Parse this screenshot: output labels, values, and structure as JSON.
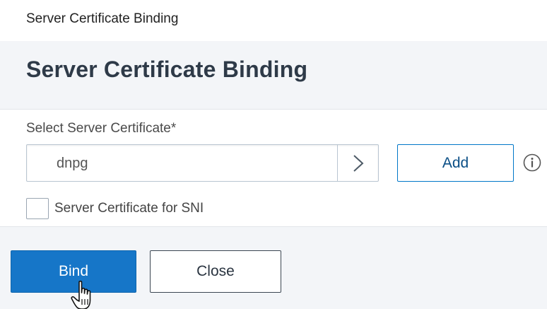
{
  "breadcrumb": "Server Certificate Binding",
  "panel": {
    "title": "Server Certificate Binding"
  },
  "form": {
    "field_label": "Select Server Certificate*",
    "selected_certificate": "dnpg",
    "add_label": "Add",
    "sni_label": "Server Certificate for SNI",
    "sni_checked": false
  },
  "footer": {
    "bind_label": "Bind",
    "close_label": "Close"
  },
  "icons": {
    "select_arrow": "chevron-right-icon",
    "info": "info-icon",
    "cursor": "hand-pointer-icon"
  },
  "colors": {
    "primary": "#1676c8",
    "header_bg": "#f3f5f8",
    "title_text": "#2e3a48"
  }
}
